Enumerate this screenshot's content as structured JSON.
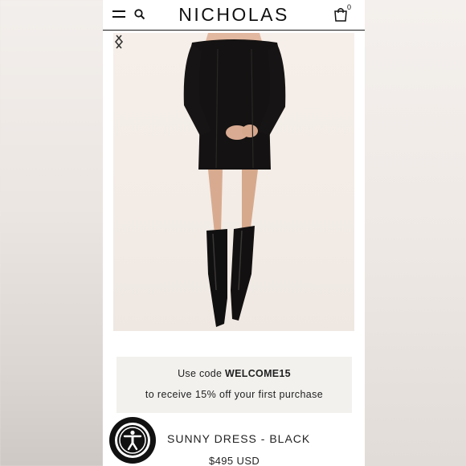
{
  "header": {
    "brand": "NICHOLAS",
    "cart_count": "0"
  },
  "icons": {
    "menu": "hamburger-menu-icon",
    "search": "search-icon",
    "bag": "shopping-bag-icon",
    "prev": "chevron-left-icon",
    "next": "chevron-right-icon",
    "accessibility": "accessibility-icon"
  },
  "promo": {
    "line1_prefix": "Use code ",
    "code": "WELCOME15",
    "line2": "to receive 15% off your first purchase"
  },
  "product": {
    "name": "SUNNY DRESS - BLACK",
    "price": "$495 USD"
  }
}
